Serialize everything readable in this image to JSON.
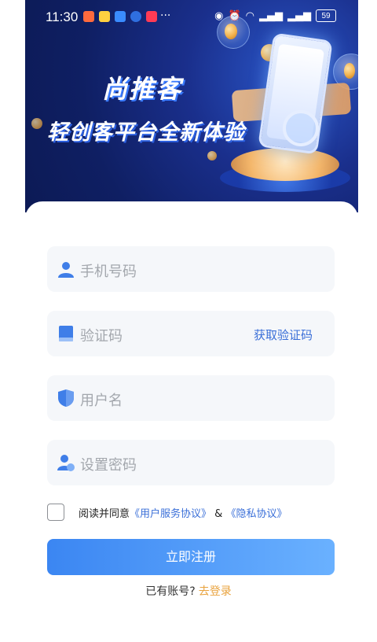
{
  "status_bar": {
    "time": "11:30",
    "more": "···",
    "battery": "59"
  },
  "banner": {
    "title": "尚推客",
    "subtitle": "轻创客平台全新体验"
  },
  "form": {
    "phone_placeholder": "手机号码",
    "code_placeholder": "验证码",
    "get_code_label": "获取验证码",
    "username_placeholder": "用户名",
    "password_placeholder": "设置密码"
  },
  "agreement": {
    "prefix": "阅读并同意",
    "user_agreement": "《用户服务协议》",
    "and": "&",
    "privacy": "《隐私协议》"
  },
  "register_button": "立即注册",
  "login_prompt": {
    "text": "已有账号?",
    "link": "去登录"
  },
  "colors": {
    "accent_blue": "#3a6fd8",
    "link_orange": "#e9a33e",
    "icon_blue": "#3f7ee8"
  }
}
